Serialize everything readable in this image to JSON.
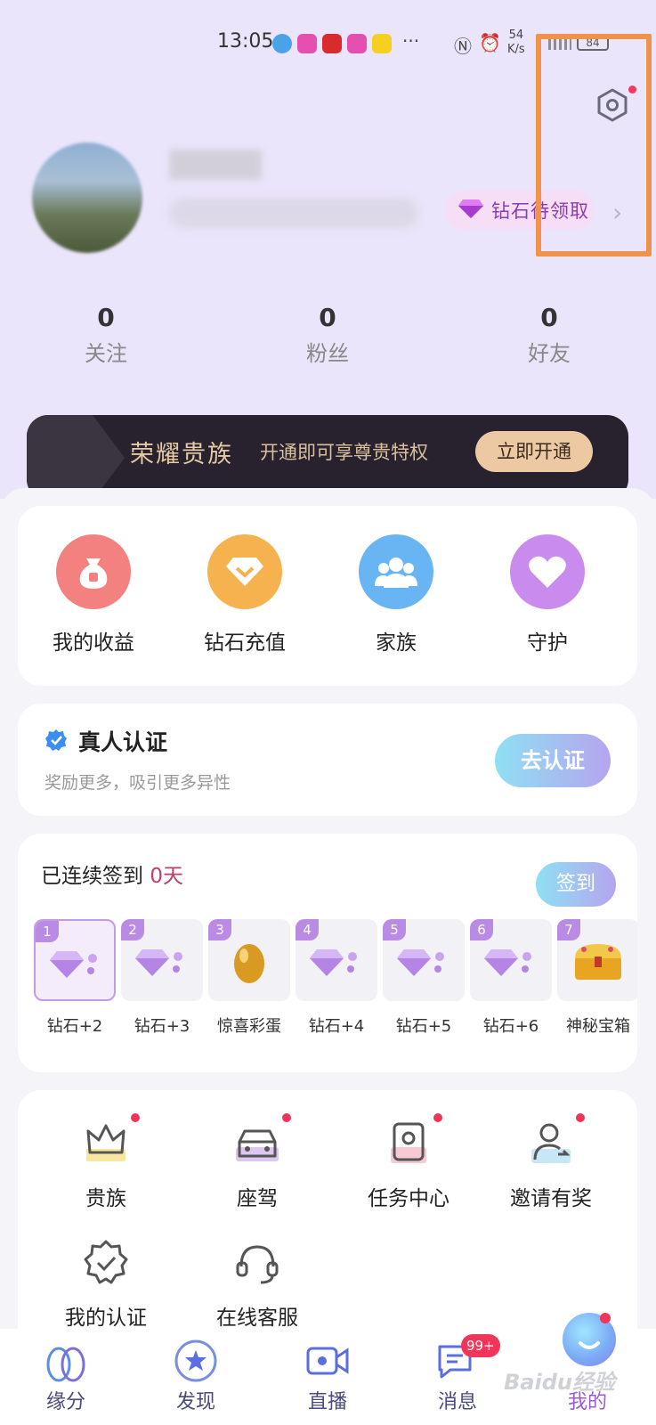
{
  "status_bar": {
    "time": "13:05",
    "net_speed_value": "54",
    "net_speed_unit": "K/s",
    "battery": "84",
    "more": "···"
  },
  "profile": {
    "diamond_button": "钻石待领取",
    "stats": [
      {
        "value": "0",
        "label": "关注"
      },
      {
        "value": "0",
        "label": "粉丝"
      },
      {
        "value": "0",
        "label": "好友"
      }
    ]
  },
  "noble_banner": {
    "title": "荣耀贵族",
    "subtitle": "开通即可享尊贵特权",
    "button": "立即开通"
  },
  "quick_actions": [
    {
      "label": "我的收益",
      "icon": "money-bag-icon",
      "color": "#f2817f"
    },
    {
      "label": "钻石充值",
      "icon": "diamond-icon",
      "color": "#f5b24e"
    },
    {
      "label": "家族",
      "icon": "family-icon",
      "color": "#69b4f2"
    },
    {
      "label": "守护",
      "icon": "heart-icon",
      "color": "#c98cee"
    }
  ],
  "verification": {
    "title": "真人认证",
    "subtitle": "奖励更多，吸引更多异性",
    "button": "去认证"
  },
  "signin": {
    "title": "已连续签到 ",
    "days": "0天",
    "button": "签到",
    "rewards": [
      {
        "num": "1",
        "label": "钻石+2",
        "icon": "diamond-icon"
      },
      {
        "num": "2",
        "label": "钻石+3",
        "icon": "diamond-icon"
      },
      {
        "num": "3",
        "label": "惊喜彩蛋",
        "icon": "golden-egg-icon"
      },
      {
        "num": "4",
        "label": "钻石+4",
        "icon": "diamond-icon"
      },
      {
        "num": "5",
        "label": "钻石+5",
        "icon": "diamond-icon"
      },
      {
        "num": "6",
        "label": "钻石+6",
        "icon": "diamond-icon"
      },
      {
        "num": "7",
        "label": "神秘宝箱",
        "icon": "treasure-chest-icon"
      }
    ]
  },
  "features": [
    {
      "label": "贵族",
      "icon": "crown-icon"
    },
    {
      "label": "座驾",
      "icon": "car-icon"
    },
    {
      "label": "任务中心",
      "icon": "task-icon"
    },
    {
      "label": "邀请有奖",
      "icon": "invite-icon"
    },
    {
      "label": "我的认证",
      "icon": "certified-badge-icon"
    },
    {
      "label": "在线客服",
      "icon": "headset-icon"
    }
  ],
  "tabs": [
    {
      "label": "缘分",
      "icon": "fate-icon"
    },
    {
      "label": "发现",
      "icon": "discover-star-icon"
    },
    {
      "label": "直播",
      "icon": "live-camera-icon"
    },
    {
      "label": "消息",
      "icon": "message-icon",
      "badge": "99+"
    },
    {
      "label": "我的",
      "icon": "me-face-icon"
    }
  ],
  "watermark": "Baidu经验",
  "colors": {
    "accent": "#9b5ad8",
    "hero_bg": "#ebe5fb",
    "badge": "#f0345a",
    "highlight_box": "#f0924a"
  }
}
